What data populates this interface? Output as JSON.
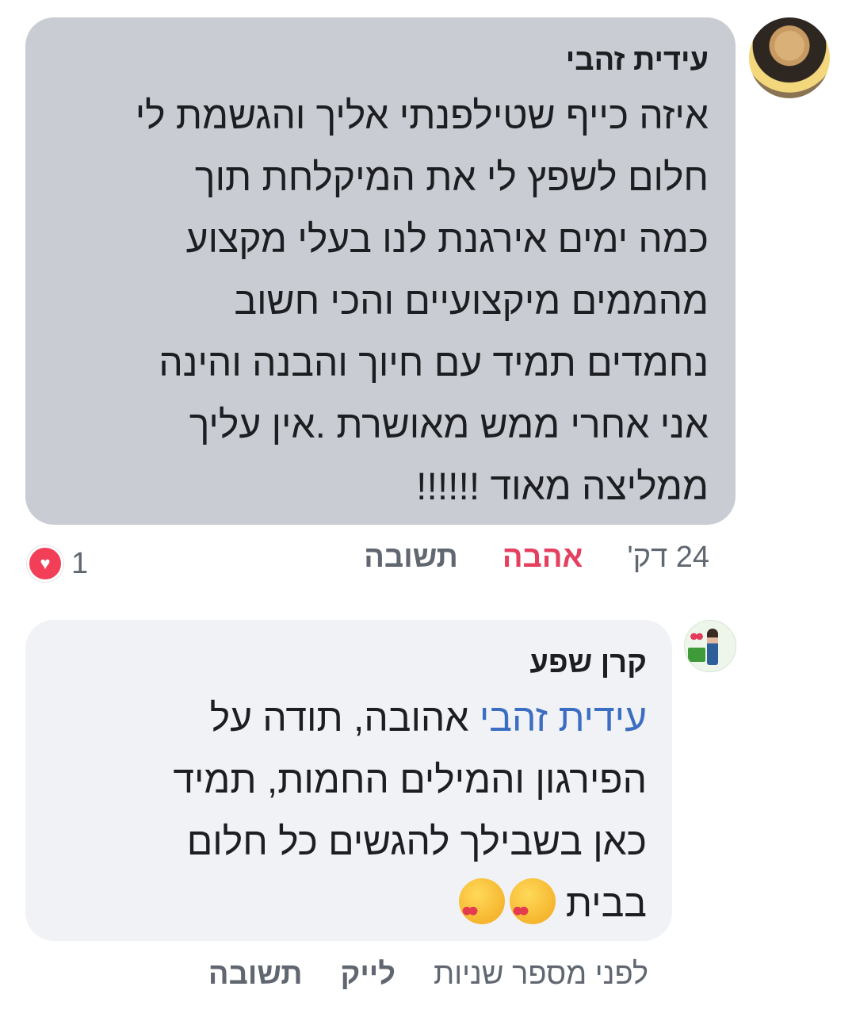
{
  "comments": [
    {
      "author": "עידית זהבי",
      "lines": [
        "איזה כייף שטילפנתי אליך והגשמת לי",
        "חלום לשפץ לי את המיקלחת תוך",
        "כמה ימים אירגנת לנו בעלי מקצוע",
        "מהממים מיקצועיים והכי חשוב",
        "נחמדים תמיד עם חיוך והבנה והינה",
        "אני אחרי ממש מאושרת .אין עליך",
        "ממליצה  מאוד !!!!!!"
      ],
      "time": "24 דק'",
      "reaction_label": "אהבה",
      "reply_label": "תשובה",
      "reaction_count": "1",
      "reaction_icon": "heart-icon"
    },
    {
      "author": "קרן שפע",
      "mention": "עידית זהבי",
      "lines": [
        " אהובה, תודה על",
        "הפירגון והמילים החמות, תמיד",
        "כאן בשבילך להגשים כל חלום",
        "בבית"
      ],
      "emojis": [
        "kissing-heart-emoji",
        "kissing-heart-emoji"
      ],
      "time": "לפני מספר שניות",
      "like_label": "לייק",
      "reply_label": "תשובה"
    }
  ],
  "colors": {
    "bubble_selected": "#c9ccd3",
    "bubble": "#f0f2f5",
    "love": "#e4405f",
    "mention": "#3b6ec2",
    "meta": "#606770"
  }
}
